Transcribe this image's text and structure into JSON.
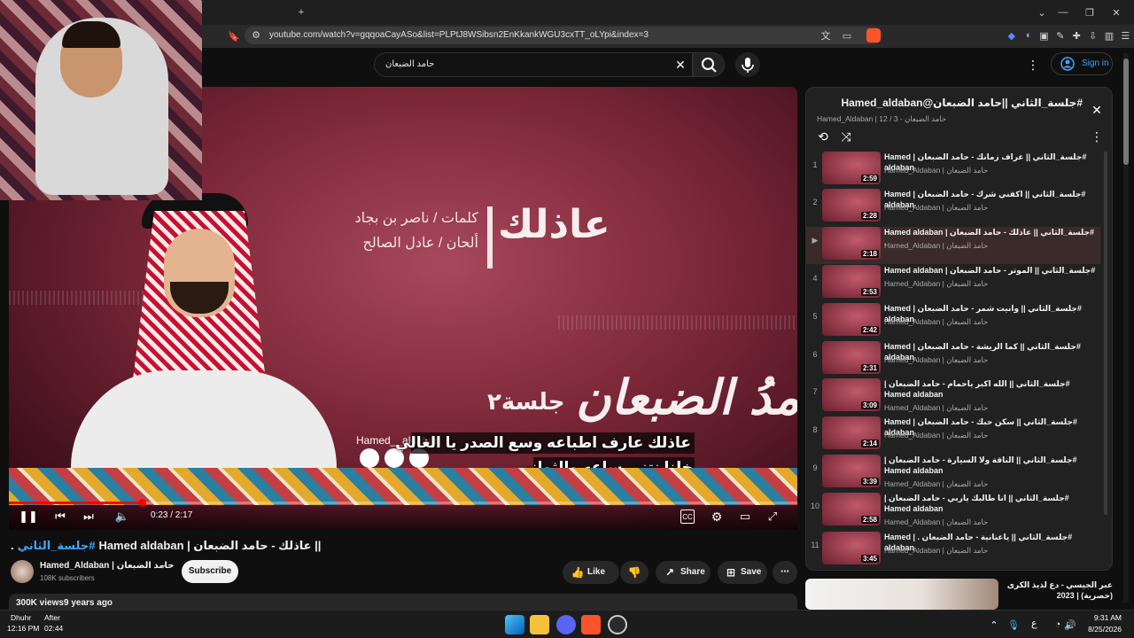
{
  "browser": {
    "new_tab_glyph": "+",
    "url": "youtube.com/watch?v=gqqoaCayASo&list=PLPtJ8WSibsn2EnKkankWGU3cxTT_oLYpi&index=3"
  },
  "header": {
    "search_value": "حامد الضبعان",
    "sign_in_label": "Sign in"
  },
  "player": {
    "song_title_art": "عاذلك",
    "lyrics_credit": "كلمات / ناصر بن بجاد",
    "melody_credit": "ألحان / عادل الصالح",
    "session_art": "جلسة٢",
    "artist_calligraphy": "حامدُ الضبعان",
    "handle_overlay": "Hamed__aldaban",
    "subtitle_line1": "عاذلك عارف اطباعه وسع الصدر يا الغالي",
    "subtitle_line2": "خلنا نتني ساعه والثواني",
    "time_display": "0:23 / 2:17",
    "progress": 0.168
  },
  "video": {
    "title_part1": "|| عاذلك - حامد الضبعان | Hamed aldaban",
    "title_hashtag": "#جلسة_الثاني",
    "title_tail": ".",
    "channel_name": "Hamed_Aldaban | حامد الضبعان",
    "subscribers": "108K subscribers",
    "subscribe_label": "Subscribe",
    "like_label": "Like",
    "share_label": "Share",
    "save_label": "Save",
    "views": "300K views",
    "age": "9 years ago"
  },
  "playlist": {
    "title": "#جلسة_الثاني ||حامد الضبعان@Hamed_aldaban",
    "subtitle": "Hamed_Aldaban | حامد الضبعان - 3 / 12",
    "items": [
      {
        "num": "1",
        "title": "#جلسة_الثاني || عراف زمانك - حامد الضبعان | Hamed aldaban",
        "channel": "Hamed_Aldaban | حامد الضبعان",
        "duration": "2:59"
      },
      {
        "num": "2",
        "title": "#جلسة_الثاني || اكفني شرك - حامد الضبعان | Hamed aldaban",
        "channel": "Hamed_Aldaban | حامد الضبعان",
        "duration": "2:28"
      },
      {
        "num": "▶",
        "title": "#جلسة_الثاني || عاذلك - حامد الضبعان | Hamed aldaban .",
        "channel": "Hamed_Aldaban | حامد الضبعان",
        "duration": "2:18"
      },
      {
        "num": "4",
        "title": "#جلسة_الثاني || الموتر - حامد الضبعان | Hamed aldaban",
        "channel": "Hamed_Aldaban | حامد الضبعان",
        "duration": "2:53"
      },
      {
        "num": "5",
        "title": "#جلسة_الثاني || وانيت شمر - حامد الضبعان | Hamed aldaban",
        "channel": "Hamed_Aldaban | حامد الضبعان",
        "duration": "2:42"
      },
      {
        "num": "6",
        "title": "#جلسة_الثاني || كما الريشة - حامد الضبعان | Hamed aldaban",
        "channel": "Hamed_Aldaban | حامد الضبعان",
        "duration": "2:31"
      },
      {
        "num": "7",
        "title": "#جلسة_الثاني || الله اكبر ياحمام - حامد الضبعان | Hamed aldaban",
        "channel": "Hamed_Aldaban | حامد الضبعان",
        "duration": "3:09"
      },
      {
        "num": "8",
        "title": "#جلسة_الثاني || سكن حبك - حامد الضبعان | Hamed aldaban",
        "channel": "Hamed_Aldaban | حامد الضبعان",
        "duration": "2:14"
      },
      {
        "num": "9",
        "title": "#جلسة_الثاني || الناقة ولا السيارة - حامد الضبعان | Hamed aldaban",
        "channel": "Hamed_Aldaban | حامد الضبعان",
        "duration": "3:39"
      },
      {
        "num": "10",
        "title": "#جلسة_الثاني || انا طالبك ياربي - حامد الضبعان | Hamed aldaban",
        "channel": "Hamed_Aldaban | حامد الضبعان",
        "duration": "2:58"
      },
      {
        "num": "11",
        "title": "#جلسة_الثاني || ياعنانية - حامد الضبعان . | Hamed aldaban",
        "channel": "Hamed_Aldaban | حامد الضبعان",
        "duration": "3:45"
      }
    ]
  },
  "recommended": {
    "title": "عبر الجيسي - دع لذيذ الكرى (حصرية) | 2023"
  },
  "taskbar": {
    "prayer_name": "Dhuhr",
    "prayer_time": "12:16 PM",
    "after_label": "After",
    "after_time": "02:44",
    "clock_time": "9:31 AM",
    "clock_date": "8/25/2026",
    "lang": "ع"
  },
  "colors": {
    "accent_red": "#ff0000",
    "link_blue": "#3ea6ff",
    "bg": "#0f0f0f"
  }
}
